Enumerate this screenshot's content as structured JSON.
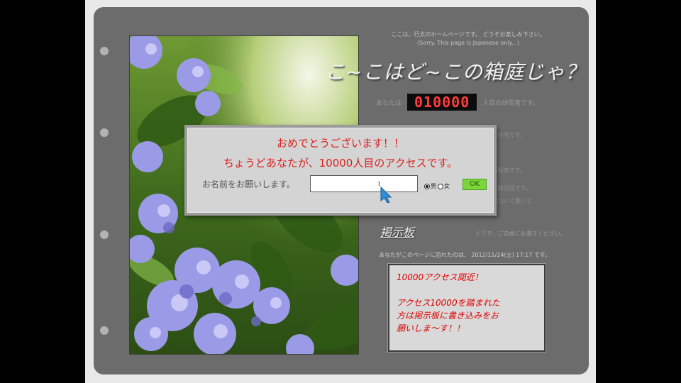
{
  "header": {
    "intro_line1": "ここは、行太のホームページです。 どうぞお楽しみ下さい。",
    "intro_line2": "(Sorry. This page is Japanese only...)",
    "site_title": "こ~こはど~この箱庭じゃ？"
  },
  "counter": {
    "value": "010000",
    "prefix": "あなたは",
    "suffix": "人目の訪問者です。"
  },
  "side_notes": {
    "note1": "の住宅です。",
    "note2": "の写真です。",
    "note3": "の旅行記です。",
    "note4": "について書いて"
  },
  "bbs": {
    "link_label": "掲示板",
    "note": "どうぞ、ご自由にお書きください。"
  },
  "visit": {
    "line": "あなたがこのページに訪れたのは、 2012/11/24(土) 17:17 です。"
  },
  "notice": {
    "line1": "10000アクセス間近！",
    "line2": "アクセス10000を踏まれた",
    "line3": "方は掲示板に書き込みをお",
    "line4": "願いしま～す！！"
  },
  "dialog": {
    "line1": "おめでとうございます！！",
    "line2": "ちょうどあなたが、10000人目のアクセスです。",
    "name_label": "お名前をお願いします。",
    "name_value": "",
    "gender_male": "男",
    "gender_female": "女",
    "gender_selected": "male",
    "ok_label": "OK"
  },
  "colors": {
    "board": "#6c6c6c",
    "counter_digits": "#ff3d3d",
    "notice_text": "#e00000",
    "ok_button": "#7bd63a"
  }
}
